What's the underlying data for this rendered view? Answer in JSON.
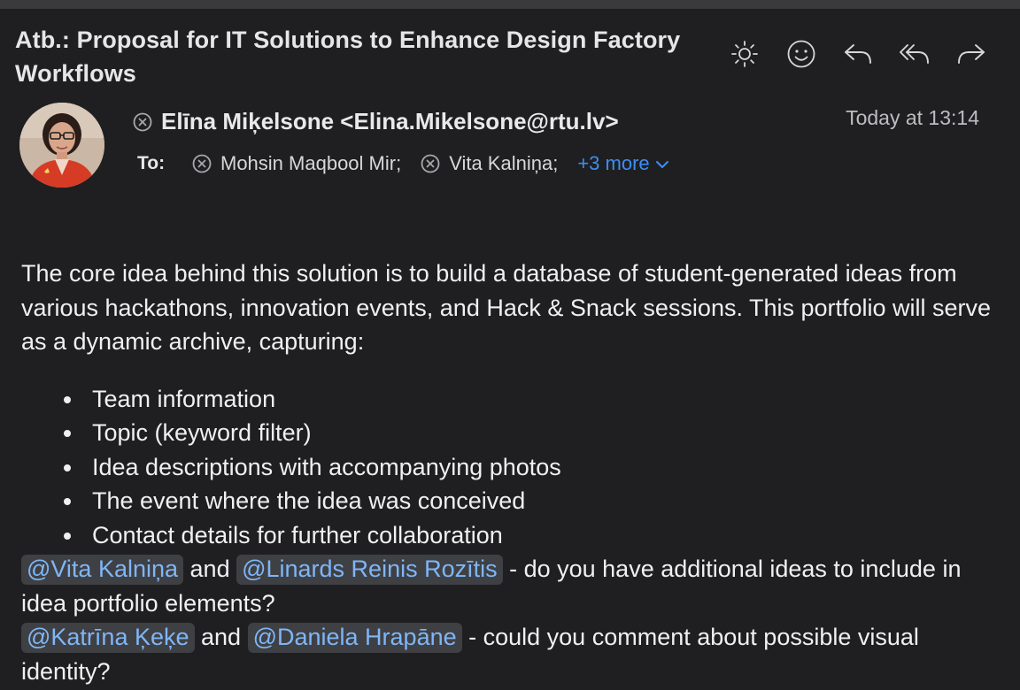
{
  "email": {
    "subject": "Atb.: Proposal for IT Solutions to Enhance Design Factory Workflows",
    "from": "Elīna Miķelsone <Elina.Mikelsone@rtu.lv>",
    "date": "Today at 13:14",
    "to_label": "To:",
    "recipients": [
      "Mohsin Maqbool Mir;",
      "Vita Kalniņa;"
    ],
    "more_recipients": "+3 more"
  },
  "toolbar": {
    "icons": [
      "sun-icon",
      "smiley-icon",
      "reply-icon",
      "reply-all-icon",
      "forward-icon"
    ]
  },
  "body": {
    "intro": "The core idea behind this solution is to build a database of student-generated ideas from various hackathons, innovation events, and Hack & Snack sessions. This portfolio will serve as a dynamic archive, capturing:",
    "bullets": [
      "Team information",
      "Topic (keyword filter)",
      "Idea descriptions with accompanying photos",
      "The event where the idea was conceived",
      "Contact details for further collaboration"
    ],
    "line1": {
      "mention1": "@Vita Kalniņa",
      "and": " and ",
      "mention2": "@Linards Reinis Rozītis",
      "rest": " - do you have additional ideas to include in idea portfolio elements?"
    },
    "line2": {
      "mention1": "@Katrīna Ķeķe",
      "and": " and ",
      "mention2": "@Daniela Hrapāne",
      "rest": " - could you comment about possible visual identity?"
    }
  },
  "colors": {
    "background": "#1f1f21",
    "accent_link": "#3d8ef5",
    "mention_text": "#7fb6f7",
    "mention_bg": "#3f4044"
  }
}
